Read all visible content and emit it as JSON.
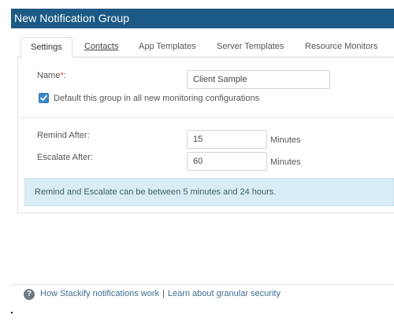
{
  "dialog": {
    "title": "New Notification Group"
  },
  "tabs": [
    {
      "label": "Settings"
    },
    {
      "label": "Contacts"
    },
    {
      "label": "App Templates"
    },
    {
      "label": "Server Templates"
    },
    {
      "label": "Resource Monitors"
    }
  ],
  "settings": {
    "name_label": "Name",
    "required_marker": "*",
    "name_colon": ":",
    "name_value": "Client Sample",
    "default_checkbox_label": "Default this group in all new monitoring configurations",
    "default_checked": true,
    "remind_label": "Remind After:",
    "remind_value": "15",
    "remind_unit": "Minutes",
    "escalate_label": "Escalate After:",
    "escalate_value": "60",
    "escalate_unit": "Minutes",
    "info_text": "Remind and Escalate can be between 5 minutes and 24 hours."
  },
  "footer": {
    "help_icon_glyph": "?",
    "link1": "How Stackify notifications work",
    "separator": "|",
    "link2": "Learn about granular security"
  },
  "colors": {
    "title_bar": "#1c5a86",
    "info_background": "#d9edf4",
    "checkbox": "#3b87c4",
    "required": "#d9534f"
  }
}
